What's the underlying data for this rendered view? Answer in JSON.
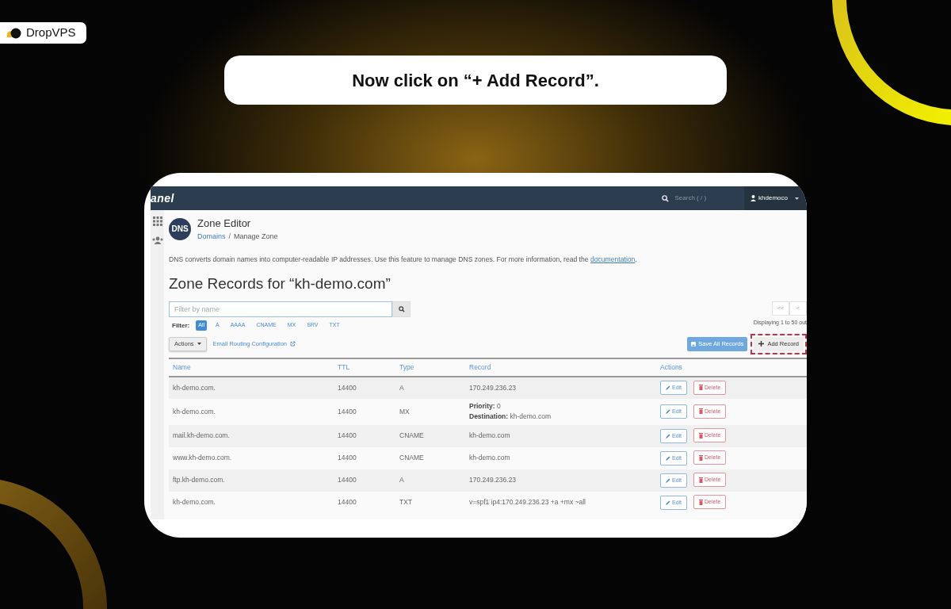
{
  "brand": {
    "name": "DropVPS"
  },
  "instruction": "Now click on “+ Add Record”.",
  "cpanel": {
    "logo": "anel",
    "search_placeholder": "Search ( / )",
    "user": "khdemoco",
    "page_icon_text": "DNS",
    "page_title": "Zone Editor",
    "breadcrumb": [
      {
        "label": "Domains",
        "kind": "link"
      },
      {
        "label": "Manage Zone",
        "kind": "current"
      }
    ],
    "breadcrumb_separator": "/",
    "description": "DNS converts domain names into computer-readable IP addresses. Use this feature to manage DNS zones. For more information, read the",
    "doc_link": "documentation",
    "doc_end": ".",
    "heading": "Zone Records for “kh-demo.com”",
    "filter_placeholder": "Filter by name",
    "filter_label": "Filter:",
    "filters": [
      {
        "label": "All",
        "selected": true
      },
      {
        "label": "A",
        "selected": false
      },
      {
        "label": "AAAA",
        "selected": false
      },
      {
        "label": "CNAME",
        "selected": false
      },
      {
        "label": "MX",
        "selected": false
      },
      {
        "label": "SRV",
        "selected": false
      },
      {
        "label": "TXT",
        "selected": false
      }
    ],
    "pagination": [
      "<<",
      "<"
    ],
    "displaying": "Displaying 1 to 50 out",
    "actions_button": "Actions",
    "email_link": "Email Routing Configuration",
    "save_button": "Save All Records",
    "add_button": {
      "label": "Add Record",
      "highlighted": true
    },
    "columns": [
      "Name",
      "TTL",
      "Type",
      "Record",
      "Actions"
    ],
    "rows": [
      {
        "name": "kh-demo.com.",
        "ttl": "14400",
        "type": "A",
        "record": [
          "170.249.236.23"
        ],
        "edit": "Edit",
        "delete": "Delete"
      },
      {
        "name": "kh-demo.com.",
        "ttl": "14400",
        "type": "MX",
        "record": [
          "**Priority:** 0",
          "**Destination:** kh-demo.com"
        ],
        "edit": "Edit",
        "delete": "Delete"
      },
      {
        "name": "mail.kh-demo.com.",
        "ttl": "14400",
        "type": "CNAME",
        "record": [
          "kh-demo.com"
        ],
        "edit": "Edit",
        "delete": "Delete"
      },
      {
        "name": "www.kh-demo.com.",
        "ttl": "14400",
        "type": "CNAME",
        "record": [
          "kh-demo.com"
        ],
        "edit": "Edit",
        "delete": "Delete"
      },
      {
        "name": "ftp.kh-demo.com.",
        "ttl": "14400",
        "type": "A",
        "record": [
          "170.249.236.23"
        ],
        "edit": "Edit",
        "delete": "Delete"
      },
      {
        "name": "kh-demo.com.",
        "ttl": "14400",
        "type": "TXT",
        "record": [
          "v=spf1 ip4:170.249.236.23 +a +mx ~all"
        ],
        "edit": "Edit",
        "delete": "Delete"
      }
    ]
  }
}
